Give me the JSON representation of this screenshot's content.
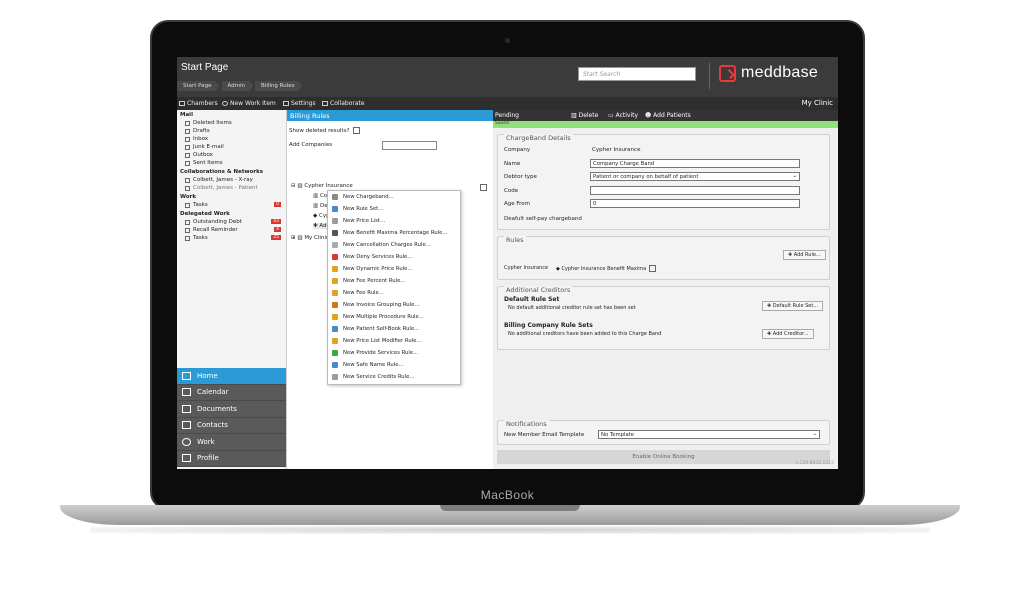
{
  "device": {
    "brand_label": "MacBook"
  },
  "header": {
    "title": "Start Page",
    "breadcrumbs": [
      "Start Page",
      "Admin",
      "Billing Rules"
    ],
    "search_placeholder": "Start Search",
    "logo_text": "meddbase",
    "accent_color": "#e63b3b"
  },
  "toolbar": {
    "chambers": "Chambers",
    "new_work_item": "New Work Item",
    "settings": "Settings",
    "collaborate": "Collaborate",
    "clinic": "My Clinic"
  },
  "leftnav": {
    "mail_heading": "Mail",
    "mail_items": [
      "Deleted Items",
      "Drafts",
      "Inbox",
      "Junk E-mail",
      "Outbox",
      "Sent Items"
    ],
    "collab_heading": "Collaborations & Networks",
    "collab_items": [
      "Colbett, James - X-ray",
      "Colbett, James - Patient"
    ],
    "work_heading": "Work",
    "work_items": [
      {
        "label": "Tasks",
        "badge": "0"
      }
    ],
    "delegated_heading": "Delegated Work",
    "delegated_items": [
      {
        "label": "Outstanding Debt",
        "badge": "43"
      },
      {
        "label": "Recall Reminder",
        "badge": "4"
      },
      {
        "label": "Tasks",
        "badge": "25"
      }
    ],
    "bottom": [
      "Home",
      "Calendar",
      "Documents",
      "Contacts",
      "Work",
      "Profile"
    ]
  },
  "billing": {
    "title": "Billing Rules",
    "show_deleted": "Show deleted results?",
    "add_companies": "Add Companies",
    "tree": {
      "company": "Cypher Insurance",
      "child1": "Comp",
      "child2": "Defa",
      "child3": "Cyph",
      "child4": "Add a",
      "clinic": "My Clinic"
    }
  },
  "context_menu": [
    "New Chargeband...",
    "New Rule Set...",
    "New Price List...",
    "New Benefit Maxima Percentage Rule...",
    "New Cancellation Charges Rule...",
    "New Deny Services Rule...",
    "New Dynamic Price Rule...",
    "New Fee Percent Rule...",
    "New Fee Rule...",
    "New Invoice Grouping Rule...",
    "New Multiple Procedure Rule...",
    "New Patient Self-Book Rule...",
    "New Price List Modifier Rule...",
    "New Provide Services Rule...",
    "New Safe Name Rule...",
    "New Service Credits Rule..."
  ],
  "right": {
    "pending": "Pending",
    "delete": "Delete",
    "activity": "Activity",
    "add_patients": "Add Patients",
    "saved": "Saved",
    "chargeband": {
      "title": "ChargeBand Details",
      "company_label": "Company",
      "company_value": "Cypher Insurance",
      "name_label": "Name",
      "name_value": "Company Charge Band",
      "debtor_label": "Debtor type",
      "debtor_value": "Patient or company on behalf of patient",
      "code_label": "Code",
      "code_value": "",
      "age_label": "Age From",
      "age_value": "0",
      "default_label": "Deafult self-pay chargeband"
    },
    "rules": {
      "title": "Rules",
      "add_rule": "Add Rule...",
      "company": "Cypher Insurance",
      "rule": "Cypher Insurance Benefit Maxima"
    },
    "creditors": {
      "title": "Additional Creditors",
      "default_title": "Default Rule Set",
      "default_text": "No default additional creditor rule set has been set",
      "default_btn": "Default Rule Set...",
      "billing_title": "Billing Company Rule Sets",
      "billing_text": "No additional creditors have been added to this Charge Band",
      "add_creditor": "Add Creditor..."
    },
    "notifications": {
      "title": "Notifications",
      "label": "New Member Email Template",
      "value": "No Template"
    },
    "enable_online": "Enable Online Booking",
    "version": "1.120.8035.1315"
  }
}
